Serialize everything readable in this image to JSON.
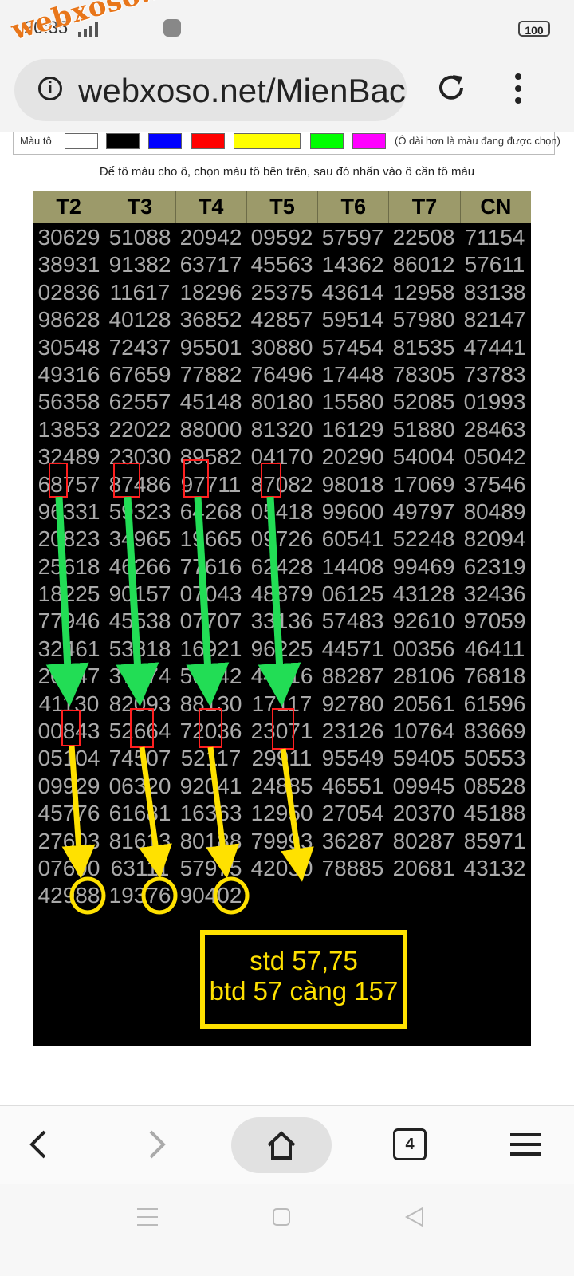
{
  "status_bar": {
    "time": "20:35",
    "battery": "100"
  },
  "watermark": "webxoso.net",
  "browser": {
    "url": "webxoso.net/MienBac",
    "tab_count": "4"
  },
  "palette": {
    "label": "Màu tô",
    "swatches": [
      "#ffffff",
      "#000000",
      "#0000ff",
      "#ff0000",
      "#ffff00",
      "#00ff00",
      "#ff00ff"
    ],
    "note": "(Ô dài hơn là màu đang được chọn)"
  },
  "instruction": "Để tô màu cho ô, chọn màu tô bên trên, sau đó nhấn vào ô cần tô màu",
  "grid": {
    "headers": [
      "T2",
      "T3",
      "T4",
      "T5",
      "T6",
      "T7",
      "CN"
    ],
    "rows": [
      [
        "30629",
        "51088",
        "20942",
        "09592",
        "57597",
        "22508",
        "71154"
      ],
      [
        "38931",
        "91382",
        "63717",
        "45563",
        "14362",
        "86012",
        "57611"
      ],
      [
        "02836",
        "11617",
        "18296",
        "25375",
        "43614",
        "12958",
        "83138"
      ],
      [
        "98628",
        "40128",
        "36852",
        "42857",
        "59514",
        "57980",
        "82147"
      ],
      [
        "30548",
        "72437",
        "95501",
        "30880",
        "57454",
        "81535",
        "47441"
      ],
      [
        "49316",
        "67659",
        "77882",
        "76496",
        "17448",
        "78305",
        "73783"
      ],
      [
        "56358",
        "62557",
        "45148",
        "80180",
        "15580",
        "52085",
        "01993"
      ],
      [
        "13853",
        "22022",
        "88000",
        "81320",
        "16129",
        "51880",
        "28463"
      ],
      [
        "32489",
        "23030",
        "89582",
        "04170",
        "20290",
        "54004",
        "05042"
      ],
      [
        "68757",
        "87486",
        "97711",
        "87082",
        "98018",
        "17069",
        "37546"
      ],
      [
        "96331",
        "59323",
        "64268",
        "05418",
        "99600",
        "49797",
        "80489"
      ],
      [
        "20823",
        "34965",
        "19665",
        "09726",
        "60541",
        "52248",
        "82094"
      ],
      [
        "25618",
        "46266",
        "77616",
        "62428",
        "14408",
        "99469",
        "62319"
      ],
      [
        "18225",
        "90157",
        "07043",
        "48879",
        "06125",
        "43128",
        "32436"
      ],
      [
        "77946",
        "45538",
        "07707",
        "33136",
        "57483",
        "92610",
        "97059"
      ],
      [
        "32461",
        "53818",
        "16921",
        "96225",
        "44571",
        "00356",
        "46411"
      ],
      [
        "20147",
        "37374",
        "56342",
        "44216",
        "88287",
        "28106",
        "76818"
      ],
      [
        "41130",
        "82093",
        "88130",
        "17117",
        "92780",
        "20561",
        "61596"
      ],
      [
        "00843",
        "52664",
        "72036",
        "23071",
        "23126",
        "10764",
        "83669"
      ],
      [
        "05104",
        "74507",
        "52117",
        "29911",
        "95549",
        "59405",
        "50553"
      ],
      [
        "09929",
        "06320",
        "92041",
        "24885",
        "46551",
        "09945",
        "08528"
      ],
      [
        "45776",
        "61681",
        "16363",
        "12950",
        "27054",
        "20370",
        "45188"
      ],
      [
        "27603",
        "81613",
        "80188",
        "79993",
        "36287",
        "80287",
        "85971"
      ],
      [
        "07690",
        "63111",
        "57975",
        "42030",
        "78885",
        "20681",
        "43132"
      ],
      [
        "42988",
        "19376",
        "90402",
        "",
        "",
        "",
        ""
      ]
    ]
  },
  "result": {
    "line1": "std 57,75",
    "line2": "btd 57 càng 157"
  },
  "colors": {
    "header_bg": "#9c9a6a",
    "grid_bg": "#000000",
    "number": "#aaaaaa",
    "arrow_green": "#22dd55",
    "arrow_yellow": "#ffe100",
    "highlight_red": "#ff2020"
  }
}
